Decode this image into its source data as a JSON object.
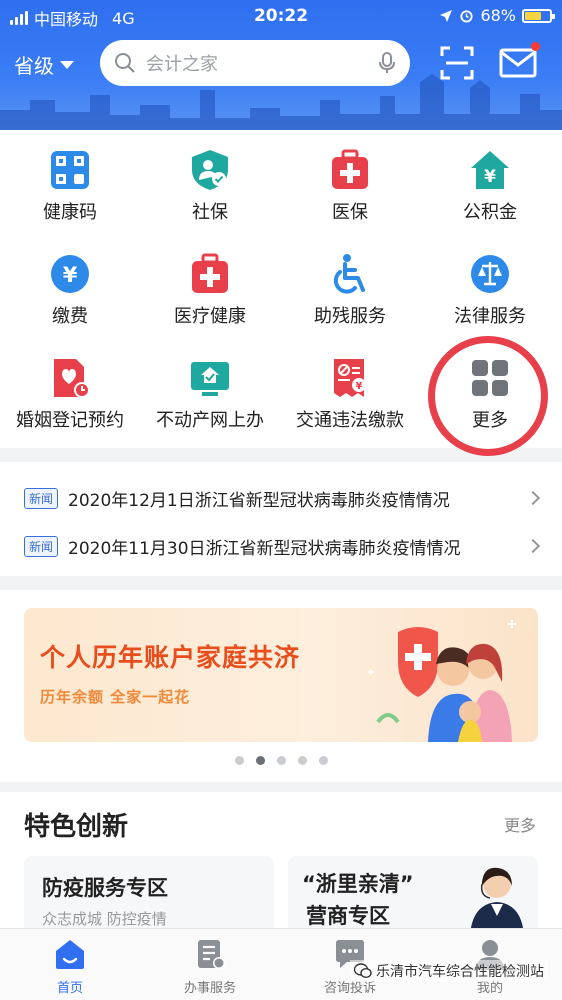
{
  "status_bar": {
    "carrier": "中国移动",
    "network": "4G",
    "time": "20:22",
    "battery": "68%",
    "battery_level": 0.68
  },
  "header": {
    "region": "省级",
    "search_placeholder": "会计之家"
  },
  "services": [
    {
      "label": "健康码",
      "icon": "health-code-icon"
    },
    {
      "label": "社保",
      "icon": "social-security-icon"
    },
    {
      "label": "医保",
      "icon": "medical-insurance-icon"
    },
    {
      "label": "公积金",
      "icon": "housing-fund-icon"
    },
    {
      "label": "缴费",
      "icon": "payment-icon"
    },
    {
      "label": "医疗健康",
      "icon": "medical-health-icon"
    },
    {
      "label": "助残服务",
      "icon": "accessibility-icon"
    },
    {
      "label": "法律服务",
      "icon": "legal-scale-icon"
    },
    {
      "label": "婚姻登记预约",
      "icon": "marriage-icon"
    },
    {
      "label": "不动产网上办",
      "icon": "real-estate-icon"
    },
    {
      "label": "交通违法缴款",
      "icon": "traffic-fine-icon"
    },
    {
      "label": "更多",
      "icon": "more-grid-icon"
    }
  ],
  "news": {
    "tag": "新闻",
    "items": [
      "2020年12月1日浙江省新型冠状病毒肺炎疫情情况",
      "2020年11月30日浙江省新型冠状病毒肺炎疫情情况"
    ]
  },
  "banner": {
    "title": "个人历年账户家庭共济",
    "subtitle": "历年余额  全家一起花",
    "slide_count": 5,
    "active_slide": 1
  },
  "featured": {
    "title": "特色创新",
    "more": "更多",
    "cards": [
      {
        "title": "防疫服务专区",
        "subtitle": "众志成城 防控疫情"
      },
      {
        "title_line1": "“浙里亲清”",
        "title_line2": "营商专区"
      }
    ]
  },
  "tabs": [
    {
      "label": "首页",
      "active": true
    },
    {
      "label": "办事服务",
      "active": false
    },
    {
      "label": "咨询投诉",
      "active": false
    },
    {
      "label": "我的",
      "active": false
    }
  ],
  "watermark": "乐清市汽车综合性能检测站",
  "colors": {
    "primary": "#2f6ff0",
    "red": "#e8404a",
    "teal": "#1fa8a0",
    "blue": "#2d8ae8"
  }
}
